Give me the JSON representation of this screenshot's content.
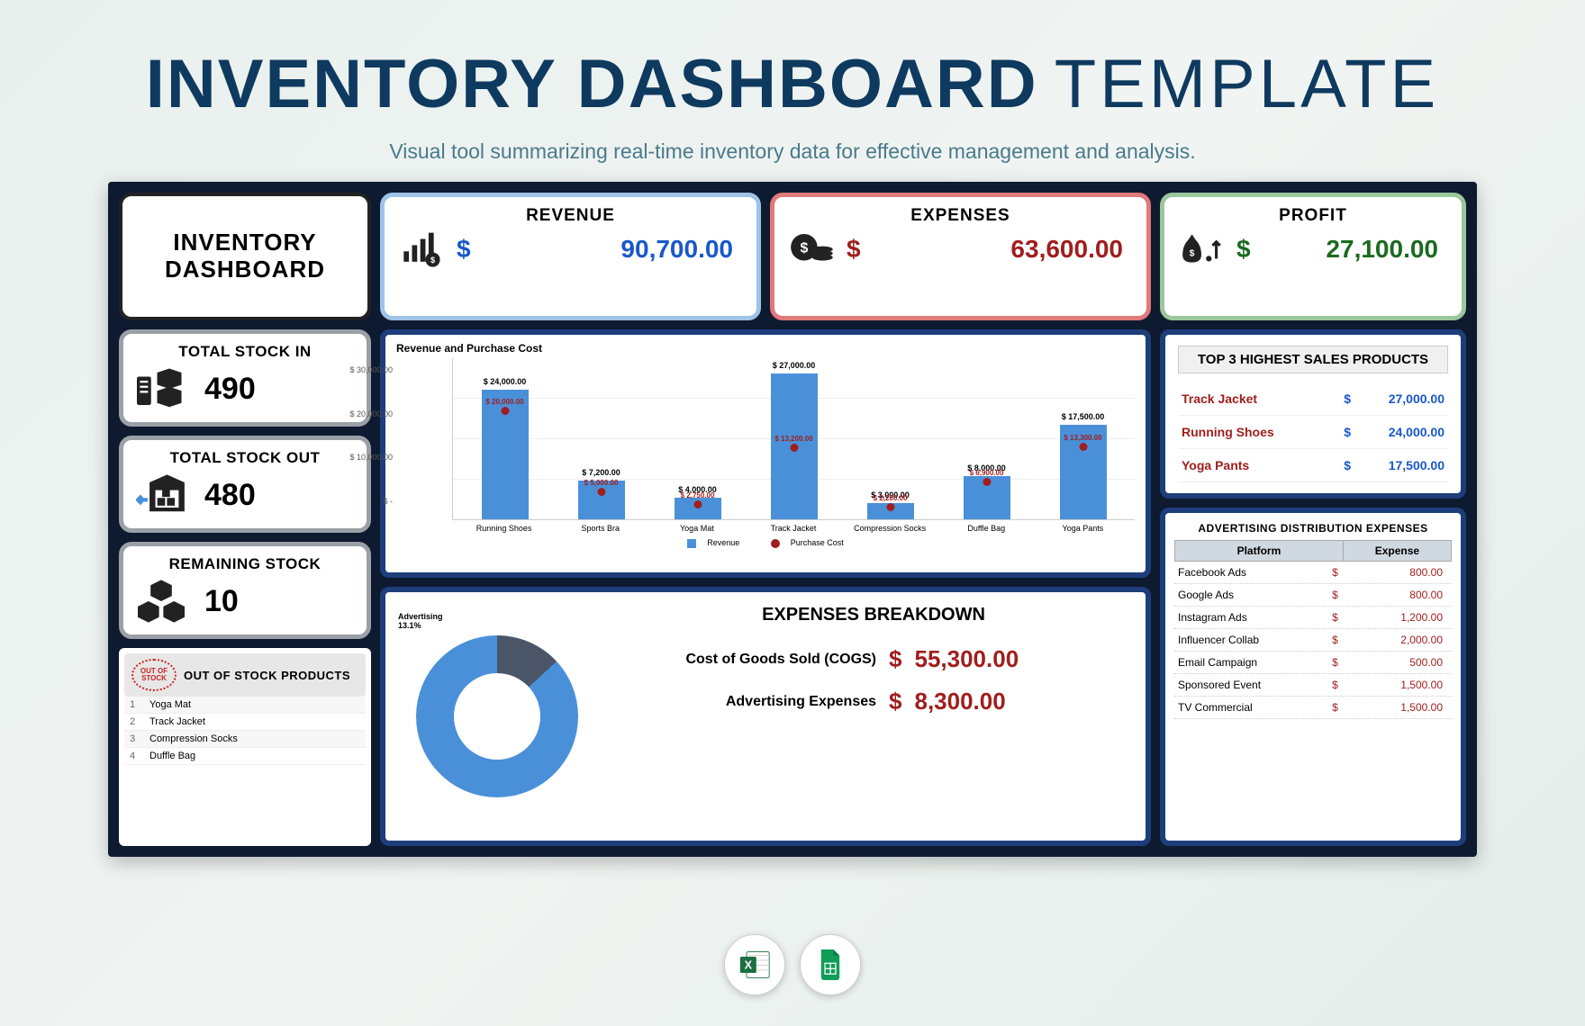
{
  "header": {
    "title_bold": "INVENTORY DASHBOARD",
    "title_thin": "TEMPLATE",
    "subtitle": "Visual tool summarizing real-time inventory data for effective management and analysis."
  },
  "main_panel_title": "INVENTORY DASHBOARD",
  "kpis": {
    "revenue": {
      "label": "REVENUE",
      "currency": "$",
      "value": "90,700.00"
    },
    "expenses": {
      "label": "EXPENSES",
      "currency": "$",
      "value": "63,600.00"
    },
    "profit": {
      "label": "PROFIT",
      "currency": "$",
      "value": "27,100.00"
    }
  },
  "stats": {
    "stock_in": {
      "label": "TOTAL STOCK IN",
      "value": "490"
    },
    "stock_out": {
      "label": "TOTAL STOCK OUT",
      "value": "480"
    },
    "remaining": {
      "label": "REMAINING STOCK",
      "value": "10"
    }
  },
  "out_of_stock": {
    "badge": "OUT OF STOCK",
    "title": "OUT OF STOCK PRODUCTS",
    "items": [
      "Yoga Mat",
      "Track Jacket",
      "Compression Socks",
      "Duffle Bag"
    ]
  },
  "chart_data": {
    "type": "bar",
    "title": "Revenue  and  Purchase Cost",
    "categories": [
      "Running Shoes",
      "Sports Bra",
      "Yoga Mat",
      "Track Jacket",
      "Compression Socks",
      "Duffle Bag",
      "Yoga Pants"
    ],
    "series": [
      {
        "name": "Revenue",
        "values": [
          24000,
          7200,
          4000,
          27000,
          3000,
          8000,
          17500
        ]
      },
      {
        "name": "Purchase Cost",
        "values": [
          20000,
          5000,
          2750,
          13200,
          2200,
          6900,
          13300
        ]
      }
    ],
    "bar_labels": [
      "$ 24,000.00",
      "$ 7,200.00",
      "$ 4,000.00",
      "$ 27,000.00",
      "$ 3,000.00",
      "$ 8,000.00",
      "$ 17,500.00"
    ],
    "cost_labels": [
      "$ 20,000.00",
      "$ 5,000.00",
      "$ 2,750.00",
      "$ 13,200.00",
      "$ 2,200.00",
      "$ 6,900.00",
      "$ 13,300.00"
    ],
    "ylabel": "",
    "xlabel": "",
    "y_ticks": [
      "$ 30,000.00",
      "$ 20,000.00",
      "$ 10,000.00",
      "$ -"
    ],
    "ylim": [
      0,
      30000
    ],
    "legend": [
      "Revenue",
      "Purchase Cost"
    ]
  },
  "expenses_breakdown": {
    "title": "EXPENSES BREAKDOWN",
    "donut_label": "Advertising",
    "donut_pct": "13.1%",
    "rows": [
      {
        "label": "Cost of Goods Sold (COGS)",
        "currency": "$",
        "value": "55,300.00"
      },
      {
        "label": "Advertising Expenses",
        "currency": "$",
        "value": "8,300.00"
      }
    ]
  },
  "top_products": {
    "title": "TOP 3 HIGHEST SALES PRODUCTS",
    "rows": [
      {
        "name": "Track Jacket",
        "currency": "$",
        "value": "27,000.00"
      },
      {
        "name": "Running Shoes",
        "currency": "$",
        "value": "24,000.00"
      },
      {
        "name": "Yoga Pants",
        "currency": "$",
        "value": "17,500.00"
      }
    ]
  },
  "advertising": {
    "title": "ADVERTISING DISTRIBUTION EXPENSES",
    "col1": "Platform",
    "col2": "Expense",
    "rows": [
      {
        "name": "Facebook Ads",
        "currency": "$",
        "value": "800.00"
      },
      {
        "name": "Google Ads",
        "currency": "$",
        "value": "800.00"
      },
      {
        "name": "Instagram Ads",
        "currency": "$",
        "value": "1,200.00"
      },
      {
        "name": "Influencer Collab",
        "currency": "$",
        "value": "2,000.00"
      },
      {
        "name": "Email Campaign",
        "currency": "$",
        "value": "500.00"
      },
      {
        "name": "Sponsored Event",
        "currency": "$",
        "value": "1,500.00"
      },
      {
        "name": "TV Commercial",
        "currency": "$",
        "value": "1,500.00"
      }
    ]
  },
  "colors": {
    "dark_bg": "#0e1a30",
    "blue": "#1858c9",
    "red": "#a01e1e",
    "green": "#1b6b1f",
    "bar": "#4a90d9"
  }
}
